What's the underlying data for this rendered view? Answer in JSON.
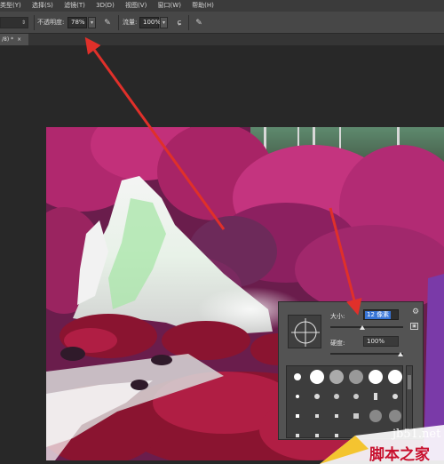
{
  "menubar": {
    "items": [
      "类型(Y)",
      "选择(S)",
      "滤镜(T)",
      "3D(D)",
      "视图(V)",
      "窗口(W)",
      "帮助(H)"
    ]
  },
  "options": {
    "opacity_label": "不透明度:",
    "opacity_value": "78%",
    "flow_label": "流量:",
    "flow_value": "100%",
    "pressure_opacity_icon": "pen-pressure-icon",
    "airbrush_icon": "airbrush-icon",
    "pressure_size_icon": "pen-pressure-size-icon"
  },
  "tab": {
    "label": "/8) *",
    "close": "×"
  },
  "brush_panel": {
    "size_label": "大小:",
    "size_value": "12 像素",
    "hardness_label": "硬度:",
    "hardness_value": "100%",
    "gear_icon": "gear-icon",
    "size_level": 0.42,
    "hardness_level": 1.0
  },
  "watermark": {
    "site": "jb51.net",
    "name": "脚本之家"
  },
  "colors": {
    "annotation_arrow": "#e0302a",
    "selection": "#3875d7",
    "watermark_red": "#c8102e"
  }
}
